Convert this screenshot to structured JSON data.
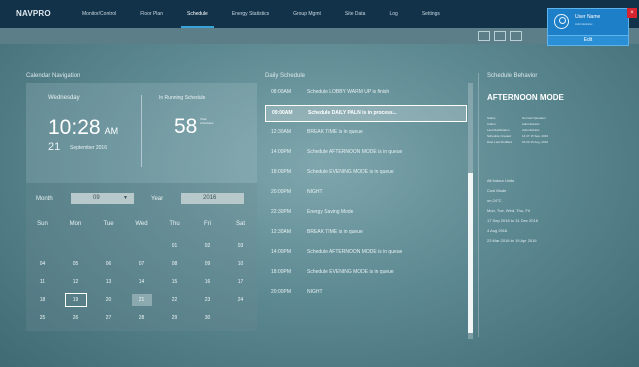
{
  "app": {
    "logo": "NAVPRO",
    "edit_label": "Edit"
  },
  "nav": {
    "items": [
      {
        "label": "Monitor/Control"
      },
      {
        "label": "Floor Plan"
      },
      {
        "label": "Schedule"
      },
      {
        "label": "Energy Statistics"
      },
      {
        "label": "Group Mgmt"
      },
      {
        "label": "Site Data"
      },
      {
        "label": "Log"
      },
      {
        "label": "Settings"
      }
    ],
    "active": "Schedule"
  },
  "user": {
    "name": "User Name",
    "role": "Administrator",
    "close_symbol": "×"
  },
  "calendar_nav": {
    "title": "Calendar Navigation",
    "weekday": "Wednesday",
    "time": "10:28",
    "ampm": "AM",
    "day": "21",
    "month_year": "September 2016",
    "running_label": "In Running Schedule",
    "running_count": "58",
    "running_unit": "Total schedules"
  },
  "calendar": {
    "month_label": "Month",
    "month_value": "09",
    "year_label": "Year",
    "year_value": "2016",
    "weekdays": [
      "Sun",
      "Mon",
      "Tue",
      "Wed",
      "Thu",
      "Fri",
      "Sat"
    ],
    "rows": [
      [
        "",
        "",
        "",
        "",
        "01",
        "02",
        "03"
      ],
      [
        "04",
        "05",
        "06",
        "07",
        "08",
        "09",
        "10"
      ],
      [
        "11",
        "12",
        "13",
        "14",
        "15",
        "16",
        "17"
      ],
      [
        "18",
        "19",
        "20",
        "21",
        "22",
        "23",
        "24"
      ],
      [
        "25",
        "26",
        "27",
        "28",
        "29",
        "30",
        ""
      ]
    ]
  },
  "schedule": {
    "title": "Daily Schedule",
    "items": [
      {
        "time": "08:00AM",
        "text": "Schedule LOBBY WARM UP is finish",
        "active": false
      },
      {
        "time": "09:00AM",
        "text": "Schedule DAILY PALN is in process...",
        "active": true
      },
      {
        "time": "12:30AM",
        "text": "BREAK TIME is in queue",
        "active": false
      },
      {
        "time": "14:00PM",
        "text": "Schedule AFTERNOON MODE is in queue",
        "active": false
      },
      {
        "time": "18:00PM",
        "text": "Schedule EVENING MODE is in queue",
        "active": false
      },
      {
        "time": "20:00PM",
        "text": "NIGHT",
        "active": false
      },
      {
        "time": "22:30PM",
        "text": "Energy Saving Mode",
        "active": false
      },
      {
        "time": "12:30AM",
        "text": "BREAK TIME is in queue",
        "active": false
      },
      {
        "time": "14:00PM",
        "text": "Schedule AFTERNOON MODE is in queue",
        "active": false
      },
      {
        "time": "18:00PM",
        "text": "Schedule EVENING MODE is in queue",
        "active": false
      },
      {
        "time": "20:00PM",
        "text": "NIGHT",
        "active": false
      }
    ]
  },
  "behavior": {
    "title": "Schedule Behavior",
    "mode": "AFTERNOON MODE",
    "fields": [
      {
        "k": "Status",
        "v": "Normal Operation"
      },
      {
        "k": "Author",
        "v": "Administrator"
      },
      {
        "k": "Last Modification",
        "v": "Administrator"
      },
      {
        "k": "Schedule Created",
        "v": "14:47 15 Sep, 2016"
      },
      {
        "k": "Date Last Modified",
        "v": "15:30 15 Aug, 2016"
      }
    ],
    "lines": [
      "All Indoor Units",
      "Cool Mode",
      "on 24°C",
      "Mon, Tue, Wed, Thu, Fri",
      "17 Sep 2016 to 31 Dec 2016",
      "4 Aug 2016",
      "23 Mar 2016 to 19 Apr 2016"
    ]
  },
  "colors": {
    "accent": "#3aa3d8",
    "close": "#d8242f",
    "topbar": "#12324a"
  }
}
